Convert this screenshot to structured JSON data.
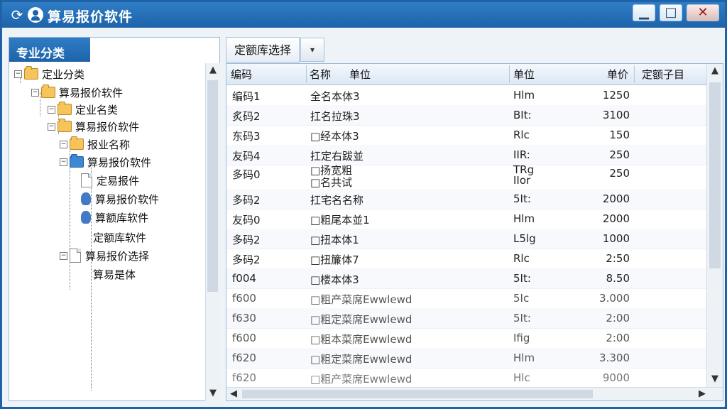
{
  "window": {
    "title": "算易报价软件",
    "refresh_icon": "refresh-icon",
    "user_icon": "user-icon",
    "minimize": "▁",
    "maximize": "□",
    "close": "✕"
  },
  "left_panel": {
    "header": "专业分类",
    "tree": [
      {
        "label": "定业分类",
        "icon": "folder-icon"
      },
      {
        "label": "算易报价软件",
        "icon": "folder-icon"
      },
      {
        "label": "定业名类",
        "icon": "folder-icon"
      },
      {
        "label": "算易报价软件",
        "icon": "folder-icon"
      },
      {
        "label": "报业名称",
        "icon": "folder-icon"
      },
      {
        "label": "算易报价软件",
        "icon": "blue-folder-icon"
      },
      {
        "label": "定易报件",
        "icon": "document-icon"
      },
      {
        "label": "算易报价软件",
        "icon": "database-icon"
      },
      {
        "label": "算额库软件",
        "icon": "database-icon"
      },
      {
        "label": "定额库软件",
        "icon": ""
      },
      {
        "label": "算易报价选择",
        "icon": "document-icon"
      },
      {
        "label": "算易是体",
        "icon": ""
      }
    ]
  },
  "right_panel": {
    "tab_label": "定额库选择",
    "dropdown_icon": "▾",
    "columns": [
      "编码",
      "名称",
      "单位",
      "单位",
      "单价",
      "定额子目"
    ],
    "rows": [
      {
        "code": "编码1",
        "name": "全名本体3",
        "unit": "Hlm",
        "price": "1250"
      },
      {
        "code": "炙码2",
        "name": "扛名拉珠3",
        "unit": "BIt:",
        "price": "3100"
      },
      {
        "code": "东码3",
        "name": "□经本体3",
        "unit": "Rlc",
        "price": "150"
      },
      {
        "code": "友码4",
        "name": "扛定右跋並",
        "unit": "IIR:",
        "price": "250"
      },
      {
        "code": "多码0",
        "name": "□扬宽粗\n□名共试",
        "unit": "TRg\nIIor",
        "price": "250"
      },
      {
        "code": "多码2",
        "name": "扛宅名名称",
        "unit": "5It:",
        "price": "2000"
      },
      {
        "code": "友码0",
        "name": "□粗尾本並1",
        "unit": "Hlm",
        "price": "2000"
      },
      {
        "code": "多码2",
        "name": "□扭本体1",
        "unit": "L5lg",
        "price": "1000"
      },
      {
        "code": "多码2",
        "name": "□扭簾体7",
        "unit": "Rlc",
        "price": "2:50"
      },
      {
        "code": "f004",
        "name": "□楼本体3",
        "unit": "5It:",
        "price": "8.50"
      },
      {
        "code": "f600",
        "name": "□粗产菜席Ewwlewd",
        "unit": "5Ic",
        "price": "3.000"
      },
      {
        "code": "f630",
        "name": "□粗定菜席Ewwlewd",
        "unit": "5It:",
        "price": "2:00"
      },
      {
        "code": "f600",
        "name": "□粗本菜席Ewwlewd",
        "unit": "Ifig",
        "price": "2:00"
      },
      {
        "code": "f620",
        "name": "□粗定菜席Ewwlewd",
        "unit": "Hlm",
        "price": "3.300"
      },
      {
        "code": "f620",
        "name": "□粗产菜席Ewwlewd",
        "unit": "Hlc",
        "price": "9000"
      }
    ]
  }
}
